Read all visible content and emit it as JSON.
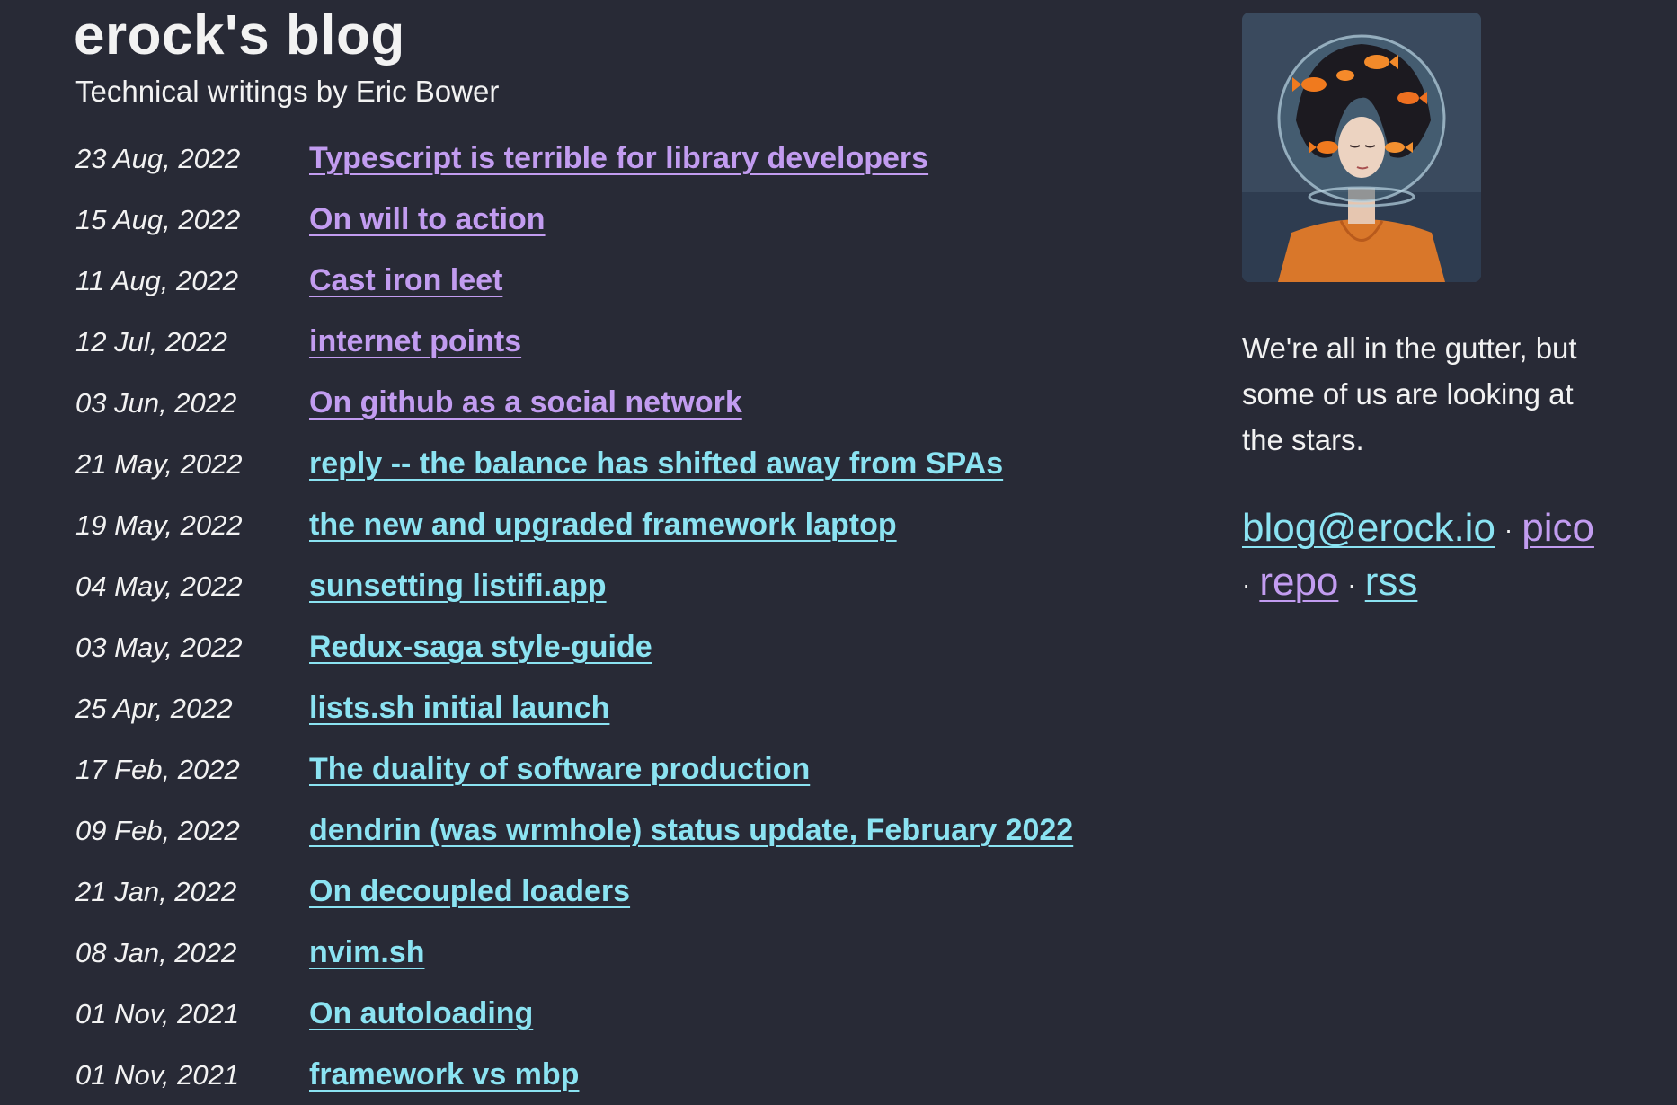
{
  "header": {
    "title": "erock's blog",
    "subtitle": "Technical writings by Eric Bower"
  },
  "posts": [
    {
      "date": "23 Aug, 2022",
      "title": "Typescript is terrible for library developers",
      "visited": true
    },
    {
      "date": "15 Aug, 2022",
      "title": "On will to action",
      "visited": true
    },
    {
      "date": "11 Aug, 2022",
      "title": "Cast iron leet",
      "visited": true
    },
    {
      "date": "12 Jul, 2022",
      "title": "internet points",
      "visited": true
    },
    {
      "date": "03 Jun, 2022",
      "title": "On github as a social network",
      "visited": true
    },
    {
      "date": "21 May, 2022",
      "title": "reply -- the balance has shifted away from SPAs",
      "visited": false
    },
    {
      "date": "19 May, 2022",
      "title": "the new and upgraded framework laptop",
      "visited": false
    },
    {
      "date": "04 May, 2022",
      "title": "sunsetting listifi.app",
      "visited": false
    },
    {
      "date": "03 May, 2022",
      "title": "Redux-saga style-guide",
      "visited": false
    },
    {
      "date": "25 Apr, 2022",
      "title": "lists.sh initial launch",
      "visited": false
    },
    {
      "date": "17 Feb, 2022",
      "title": "The duality of software production",
      "visited": false
    },
    {
      "date": "09 Feb, 2022",
      "title": "dendrin (was wrmhole) status update, February 2022",
      "visited": false
    },
    {
      "date": "21 Jan, 2022",
      "title": "On decoupled loaders",
      "visited": false
    },
    {
      "date": "08 Jan, 2022",
      "title": "nvim.sh",
      "visited": false
    },
    {
      "date": "01 Nov, 2021",
      "title": "On autoloading",
      "visited": false
    },
    {
      "date": "01 Nov, 2021",
      "title": "framework vs mbp",
      "visited": false
    }
  ],
  "sidebar": {
    "avatar_icon": "avatar-image",
    "tagline": "We're all in the gutter, but some of us are looking at the stars.",
    "links": {
      "email": "blog@erock.io",
      "pico": "pico",
      "repo": "repo",
      "rss": "rss",
      "separator": "·"
    }
  },
  "colors": {
    "background": "#282a36",
    "text": "#f2f2f2",
    "link_visited": "#c29cf0",
    "link_unvisited": "#8be3f2"
  }
}
